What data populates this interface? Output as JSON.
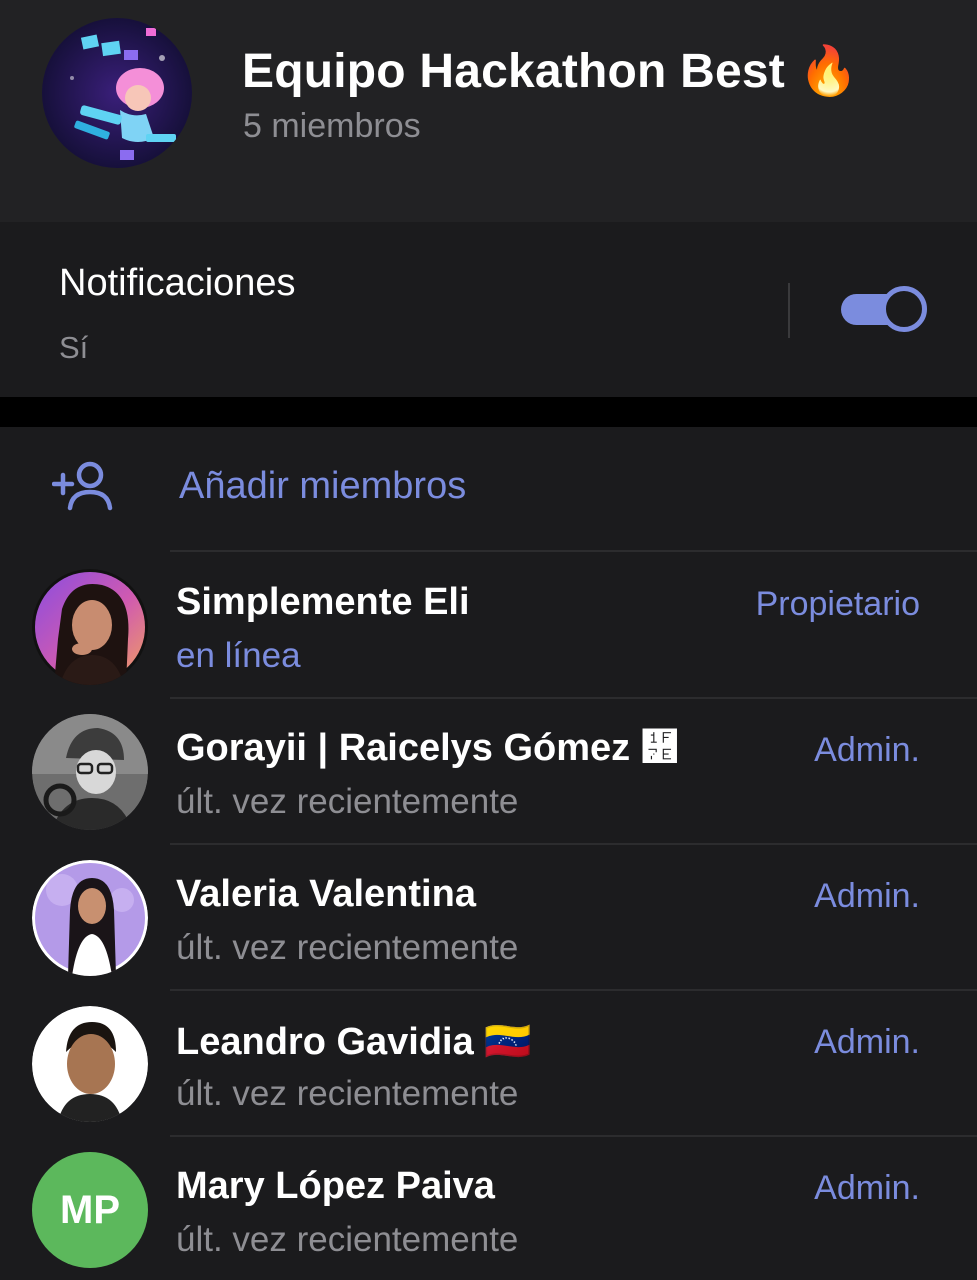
{
  "group": {
    "title": "Equipo Hackathon Best",
    "title_emoji": "🔥",
    "subtitle": "5 miembros",
    "avatar_icon": "group-illustration"
  },
  "notifications": {
    "label": "Notificaciones",
    "value": "Sí",
    "enabled": true
  },
  "add_members": {
    "label": "Añadir miembros",
    "icon": "add-person-icon"
  },
  "members": [
    {
      "name": "Simplemente Eli",
      "status": "en línea",
      "role": "Propietario",
      "online": true
    },
    {
      "name": "Gorayii | Raicelys Gómez ὾",
      "status": "últ. vez recientemente",
      "role": "Admin."
    },
    {
      "name": "Valeria Valentina",
      "status": "últ. vez recientemente",
      "role": "Admin."
    },
    {
      "name": "Leandro Gavidia",
      "flag": "🇻🇪",
      "status": "últ. vez recientemente",
      "role": "Admin."
    },
    {
      "name": "Mary López Paiva",
      "initials": "MP",
      "status": "últ. vez recientemente",
      "role": "Admin."
    }
  ],
  "colors": {
    "accent": "#7b8cde",
    "background": "#1b1b1d",
    "header": "#222224",
    "secondary_text": "#8e8e93",
    "initials_avatar": "#5cb85c"
  }
}
